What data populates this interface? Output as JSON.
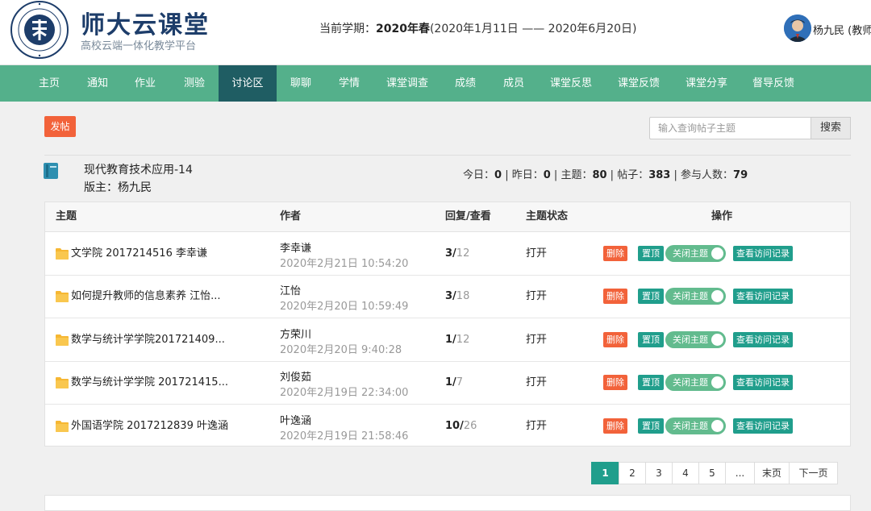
{
  "header": {
    "brand_title": "师大云课堂",
    "brand_subtitle": "高校云端一体化教学平台",
    "semester_label": "当前学期：",
    "semester_name": "2020年春",
    "semester_range": "(2020年1月11日 —— 2020年6月20日)",
    "user_name": "杨九民 (教师)"
  },
  "nav": {
    "items": [
      "主页",
      "通知",
      "作业",
      "测验",
      "讨论区",
      "聊聊",
      "学情",
      "课堂调查",
      "成绩",
      "成员",
      "课堂反思",
      "课堂反馈",
      "课堂分享",
      "督导反馈"
    ],
    "active": "讨论区"
  },
  "toolbar": {
    "post_label": "发帖",
    "search_placeholder": "输入查询帖子主题",
    "search_label": "搜索"
  },
  "forum": {
    "name": "现代教育技术应用-14",
    "moderator": "版主：杨九民",
    "stats": {
      "today_label": "今日：",
      "today": "0",
      "yesterday_label": "昨日：",
      "yesterday": "0",
      "topics_label": "主题：",
      "topics": "80",
      "posts_label": "帖子：",
      "posts": "383",
      "participants_label": "参与人数：",
      "participants": "79",
      "separator": " | "
    }
  },
  "table": {
    "headers": {
      "topic": "主题",
      "author": "作者",
      "reply_view": "回复/查看",
      "status": "主题状态",
      "actions": "操作"
    },
    "rows": [
      {
        "title": "文学院 2017214516 李幸谦",
        "author": "李幸谦",
        "time": "2020年2月21日 10:54:20",
        "replies": "3",
        "views": "12",
        "status": "打开"
      },
      {
        "title": "如何提升教师的信息素养 江怡...",
        "author": "江怡",
        "time": "2020年2月20日 10:59:49",
        "replies": "3",
        "views": "18",
        "status": "打开"
      },
      {
        "title": "数学与统计学学院201721409...",
        "author": "方荣川",
        "time": "2020年2月20日 9:40:28",
        "replies": "1",
        "views": "12",
        "status": "打开"
      },
      {
        "title": "数学与统计学学院 201721415...",
        "author": "刘俊茹",
        "time": "2020年2月19日 22:34:00",
        "replies": "1",
        "views": "7",
        "status": "打开"
      },
      {
        "title": "外国语学院 2017212839 叶逸涵",
        "author": "叶逸涵",
        "time": "2020年2月19日 21:58:46",
        "replies": "10",
        "views": "26",
        "status": "打开"
      }
    ],
    "action_labels": {
      "delete": "删除",
      "pin": "置顶",
      "close_topic": "关闭主题",
      "view_log": "查看访问记录"
    },
    "reply_separator": "/"
  },
  "pagination": {
    "pages": [
      "1",
      "2",
      "3",
      "4",
      "5",
      "...",
      "末页",
      "下一页"
    ],
    "current": "1"
  },
  "colors": {
    "nav_bg": "#54b08b",
    "nav_active": "#1f5d63",
    "danger": "#f2623a",
    "teal": "#209e8c",
    "toggle": "#62bb8e"
  }
}
